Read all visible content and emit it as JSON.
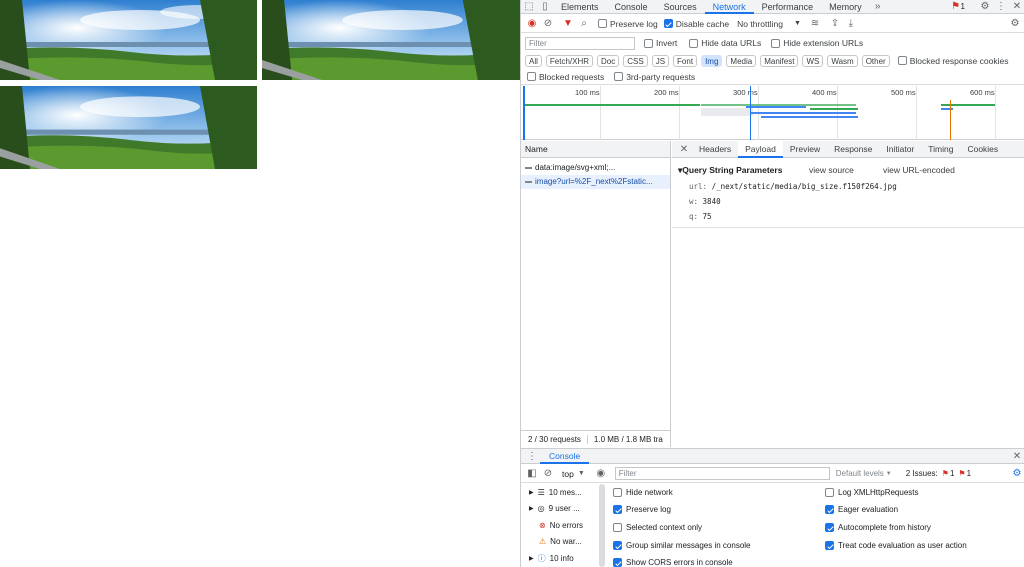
{
  "devtools": {
    "tabs": [
      "Elements",
      "Console",
      "Sources",
      "Network",
      "Performance",
      "Memory"
    ],
    "issues_badge": "1",
    "toolbar": {
      "preserve_log": "Preserve log",
      "disable_cache": "Disable cache",
      "throttling": "No throttling"
    },
    "filter": {
      "placeholder": "Filter",
      "invert": "Invert",
      "hide_data_urls": "Hide data URLs",
      "hide_extension_urls": "Hide extension URLs"
    },
    "type_chips": [
      "All",
      "Fetch/XHR",
      "Doc",
      "CSS",
      "JS",
      "Font",
      "Img",
      "Media",
      "Manifest",
      "WS",
      "Wasm",
      "Other"
    ],
    "blocked_response_cookies": "Blocked response cookies",
    "blocked_requests": "Blocked requests",
    "third_party_requests": "3rd-party requests",
    "timeline_ticks": [
      "100 ms",
      "200 ms",
      "300 ms",
      "400 ms",
      "500 ms",
      "600 ms"
    ],
    "requests": {
      "header": "Name",
      "items": [
        "data:image/svg+xml;...",
        "image?url=%2F_next%2Fstatic..."
      ]
    },
    "detail_tabs": [
      "Headers",
      "Payload",
      "Preview",
      "Response",
      "Initiator",
      "Timing",
      "Cookies"
    ],
    "payload": {
      "section": "▾Query String Parameters",
      "view_source": "view source",
      "view_url_encoded": "view URL-encoded",
      "params": [
        {
          "key": "url:",
          "value": "/_next/static/media/big_size.f150f264.jpg"
        },
        {
          "key": "w:",
          "value": "3840"
        },
        {
          "key": "q:",
          "value": "75"
        }
      ]
    },
    "status": {
      "requests": "2 / 30 requests",
      "transferred": "1.0 MB / 1.8 MB tra"
    }
  },
  "console": {
    "tab": "Console",
    "context": "top",
    "filter_placeholder": "Filter",
    "levels": "Default levels",
    "issues_label": "2 Issues:",
    "issues_error_count": "1",
    "issues_info_count": "1",
    "sidebar": [
      "10 mes...",
      "9 user ...",
      "No errors",
      "No war...",
      "10 info"
    ],
    "settings_left": [
      "Hide network",
      "Preserve log",
      "Selected context only",
      "Group similar messages in console",
      "Show CORS errors in console"
    ],
    "settings_right": [
      "Log XMLHttpRequests",
      "Eager evaluation",
      "Autocomplete from history",
      "Treat code evaluation as user action"
    ]
  }
}
